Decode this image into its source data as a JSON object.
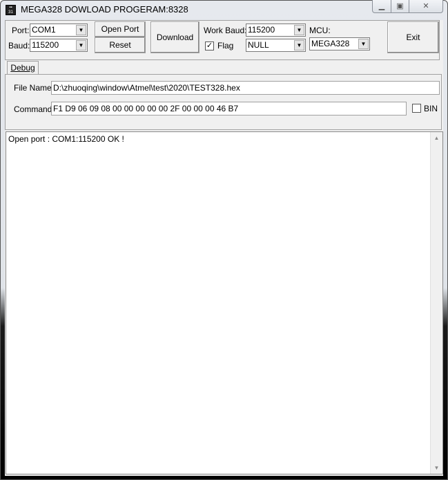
{
  "window": {
    "title": "MEGA328 DOWLOAD PROGERAM:8328",
    "icon": "app-chip-icon",
    "controls": {
      "minimize": "minimize-icon",
      "maximize": "maximize-icon",
      "close": "close-icon"
    }
  },
  "toolbar": {
    "port_label": "Port:",
    "port_value": "COM1",
    "baud_label": "Baud:",
    "baud_value": "115200",
    "open_port": "Open Port",
    "reset": "Reset",
    "download": "Download",
    "work_baud_label": "Work Baud:",
    "work_baud_value": "115200",
    "flag_label": "Flag",
    "flag_checked": true,
    "flag_value": "NULL",
    "mcu_label": "MCU:",
    "mcu_value": "MEGA328",
    "exit": "Exit"
  },
  "tabs": [
    {
      "label": "Debug",
      "active": true
    }
  ],
  "debug": {
    "file_name_label": "File Name:",
    "file_name_value": "D:\\zhuoqing\\window\\Atmel\\test\\2020\\TEST328.hex",
    "command_label": "Command:",
    "command_value": "F1 D9 06 09 08 00 00 00 00 00 2F 00 00 00 46 B7",
    "bin_label": "BIN",
    "bin_checked": false
  },
  "log": {
    "lines": [
      "Open port : COM1:115200 OK !"
    ]
  }
}
